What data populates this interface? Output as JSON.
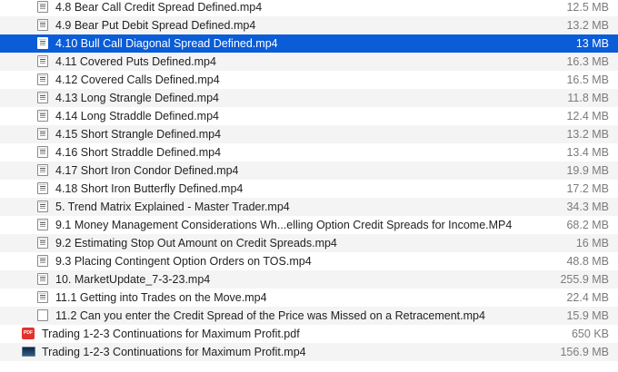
{
  "files": [
    {
      "name": "4.8 Bear Call Credit Spread Defined.mp4",
      "size": "12.5 MB",
      "icon": "video-file-icon",
      "indent": true
    },
    {
      "name": "4.9 Bear Put Debit Spread Defined.mp4",
      "size": "13.2 MB",
      "icon": "video-file-icon",
      "indent": true
    },
    {
      "name": "4.10 Bull Call Diagonal Spread Defined.mp4",
      "size": "13 MB",
      "icon": "video-file-icon",
      "indent": true,
      "selected": true
    },
    {
      "name": "4.11 Covered Puts Defined.mp4",
      "size": "16.3 MB",
      "icon": "video-file-icon",
      "indent": true
    },
    {
      "name": "4.12 Covered Calls Defined.mp4",
      "size": "16.5 MB",
      "icon": "video-file-icon",
      "indent": true
    },
    {
      "name": "4.13 Long Strangle Defined.mp4",
      "size": "11.8 MB",
      "icon": "video-file-icon",
      "indent": true
    },
    {
      "name": "4.14 Long Straddle Defined.mp4",
      "size": "12.4 MB",
      "icon": "video-file-icon",
      "indent": true
    },
    {
      "name": "4.15 Short Strangle Defined.mp4",
      "size": "13.2 MB",
      "icon": "video-file-icon",
      "indent": true
    },
    {
      "name": "4.16 Short Straddle Defined.mp4",
      "size": "13.4 MB",
      "icon": "video-file-icon",
      "indent": true
    },
    {
      "name": "4.17 Short Iron Condor Defined.mp4",
      "size": "19.9 MB",
      "icon": "video-file-icon",
      "indent": true
    },
    {
      "name": "4.18 Short Iron Butterfly Defined.mp4",
      "size": "17.2 MB",
      "icon": "video-file-icon",
      "indent": true
    },
    {
      "name": "5. Trend Matrix Explained - Master Trader.mp4",
      "size": "34.3 MB",
      "icon": "video-file-icon",
      "indent": true
    },
    {
      "name": "9.1 Money Management Considerations Wh...elling Option Credit Spreads for Income.MP4",
      "size": "68.2 MB",
      "icon": "video-file-icon",
      "indent": true
    },
    {
      "name": "9.2 Estimating Stop Out Amount on Credit Spreads.mp4",
      "size": "16 MB",
      "icon": "video-file-icon",
      "indent": true
    },
    {
      "name": "9.3 Placing Contingent Option Orders on TOS.mp4",
      "size": "48.8 MB",
      "icon": "video-file-icon",
      "indent": true
    },
    {
      "name": "10. MarketUpdate_7-3-23.mp4",
      "size": "255.9 MB",
      "icon": "video-file-icon",
      "indent": true
    },
    {
      "name": "11.1 Getting into Trades on the Move.mp4",
      "size": "22.4 MB",
      "icon": "video-file-icon",
      "indent": true
    },
    {
      "name": "11.2 Can you enter the Credit Spread of the Price was Missed on a Retracement.mp4",
      "size": "15.9 MB",
      "icon": "blank-file-icon",
      "indent": true
    },
    {
      "name": "Trading 1-2-3 Continuations for Maximum Profit.pdf",
      "size": "650 KB",
      "icon": "pdf-file-icon",
      "indent": false,
      "badge": "PDF"
    },
    {
      "name": "Trading 1-2-3 Continuations for Maximum Profit.mp4",
      "size": "156.9 MB",
      "icon": "video-thumbnail-icon",
      "indent": false
    }
  ],
  "colors": {
    "selection": "#0a5cd7",
    "alt_row": "#f4f4f5",
    "size_text": "#7b7b7b"
  }
}
